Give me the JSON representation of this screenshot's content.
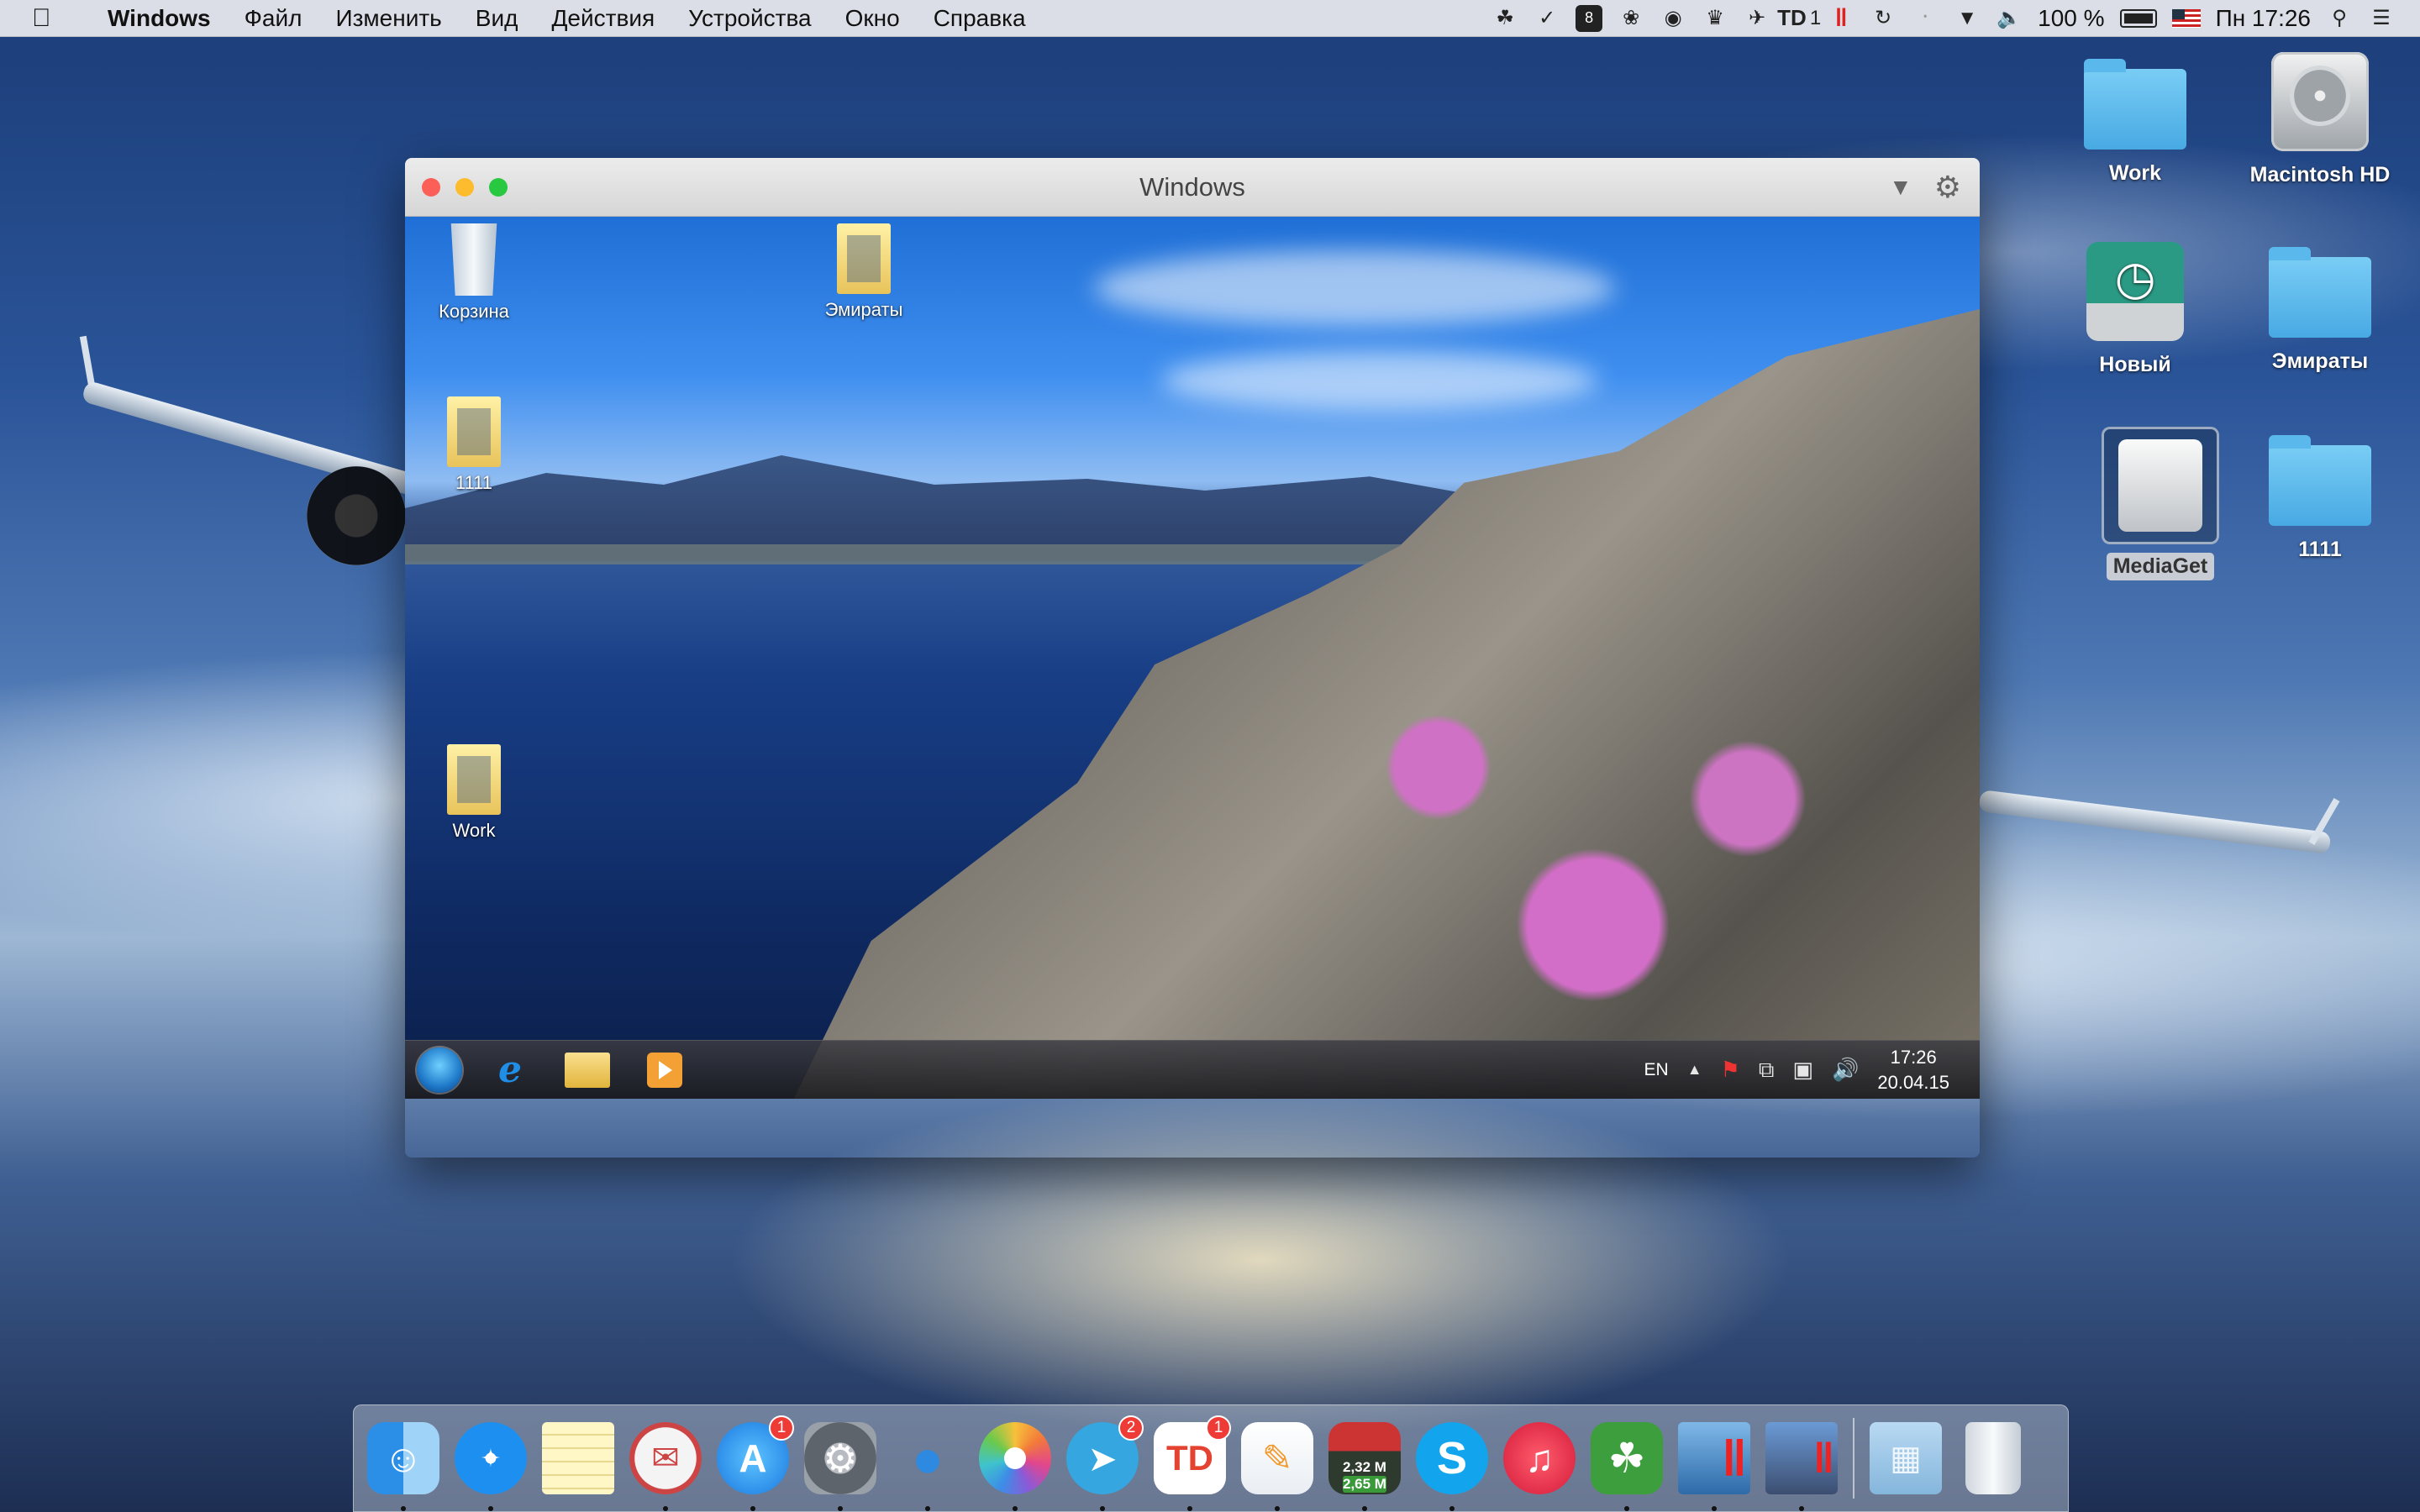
{
  "menubar": {
    "apple_icon": "apple-icon",
    "app_name": "Windows",
    "menus": [
      "Файл",
      "Изменить",
      "Вид",
      "Действия",
      "Устройства",
      "Окно",
      "Справка"
    ],
    "td_label": "1",
    "battery": "100 %",
    "clock": "Пн 17:26"
  },
  "mac_desktop": {
    "icons": [
      "Work",
      "Macintosh HD",
      "Новый",
      "Эмираты",
      "MediaGet",
      "1111"
    ]
  },
  "vm_window": {
    "title": "Windows",
    "desktop_icons": [
      "Корзина",
      "Эмираты",
      "1111",
      "Work"
    ],
    "taskbar": {
      "language": "EN",
      "time": "17:26",
      "date": "20.04.15"
    }
  },
  "dock": {
    "apps": [
      {
        "name": "Finder",
        "icon": "finder-icon",
        "badge": ""
      },
      {
        "name": "Safari",
        "icon": "safari-icon",
        "badge": ""
      },
      {
        "name": "Notes",
        "icon": "notes-icon",
        "badge": ""
      },
      {
        "name": "Airmail",
        "icon": "airmail-icon",
        "badge": ""
      },
      {
        "name": "App Store",
        "icon": "app-store-icon",
        "badge": "1"
      },
      {
        "name": "System Preferences",
        "icon": "system-preferences-icon",
        "badge": ""
      },
      {
        "name": "Tweetbot",
        "icon": "tweetbot-icon",
        "badge": ""
      },
      {
        "name": "Photos",
        "icon": "photos-icon",
        "badge": ""
      },
      {
        "name": "Telegram",
        "icon": "telegram-icon",
        "badge": "2"
      },
      {
        "name": "Todoist",
        "icon": "todoist-icon",
        "badge": "1"
      },
      {
        "name": "Pages",
        "icon": "pages-icon",
        "badge": ""
      },
      {
        "name": "Network monitor",
        "icon": "network-monitor-icon",
        "badge": "",
        "up": "2,32 M",
        "down": "2,65 M"
      },
      {
        "name": "Skype",
        "icon": "skype-icon",
        "badge": ""
      },
      {
        "name": "iTunes",
        "icon": "itunes-icon",
        "badge": ""
      },
      {
        "name": "Evernote",
        "icon": "evernote-icon",
        "badge": ""
      },
      {
        "name": "Parallels Desktop",
        "icon": "parallels-icon",
        "badge": ""
      },
      {
        "name": "Windows VM",
        "icon": "windows-vm-icon",
        "badge": ""
      }
    ],
    "stack_icons": [
      "applications-folder-icon",
      "trash-icon"
    ]
  },
  "colors": {
    "close": "#fc5f57",
    "minimize": "#fdbc2e",
    "maximize": "#28c840",
    "badge": "#ef3b36",
    "folder": "#48a9e3"
  }
}
